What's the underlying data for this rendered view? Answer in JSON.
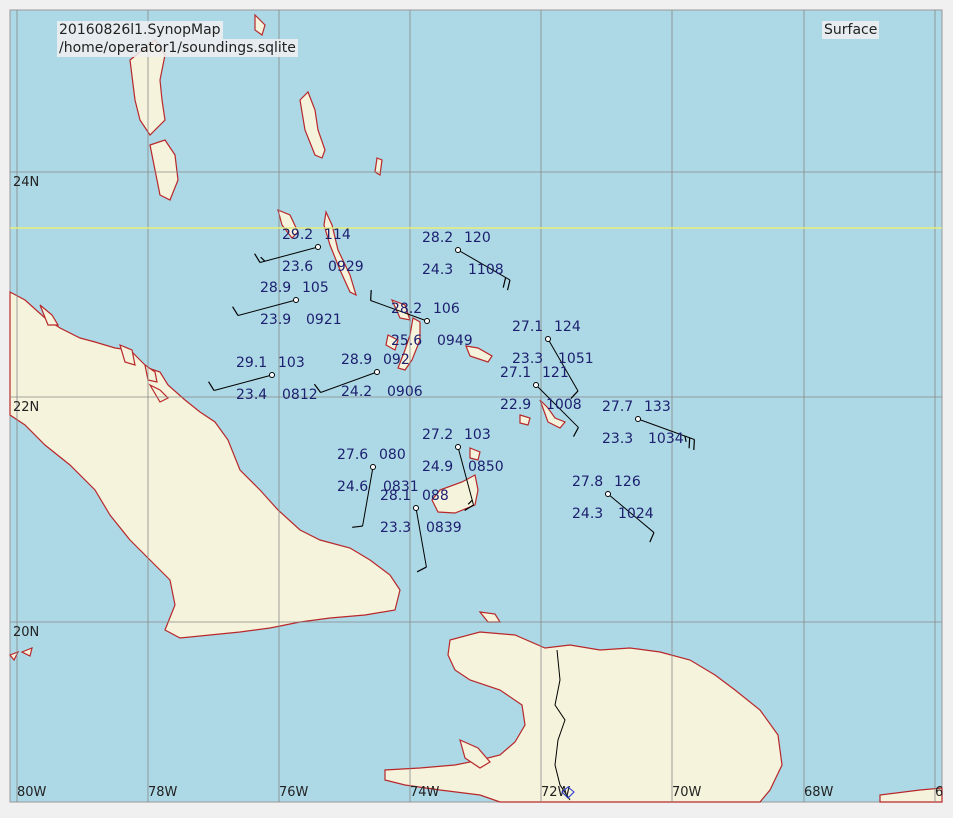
{
  "header": {
    "title": "20160826l1.SynopMap",
    "db_path": "/home/operator1/soundings.sqlite",
    "level": "Surface"
  },
  "colors": {
    "ocean": "#add8e6",
    "land": "#f5f3dc",
    "coast": "#b8282a",
    "grid": "#888888",
    "highlight_line": "#e6ee7a",
    "station_text": "#1c1f6e",
    "barb": "#000000"
  },
  "grid": {
    "lat_labels": [
      "24N",
      "22N",
      "20N"
    ],
    "lon_labels": [
      "80W",
      "78W",
      "76W",
      "74W",
      "72W",
      "70W",
      "68W",
      "6"
    ]
  },
  "stations": [
    {
      "temp": "29.2",
      "dew": "23.6",
      "pres": "114",
      "time": "0929",
      "wind_dir": 255,
      "wind_kt": 15
    },
    {
      "temp": "28.2",
      "dew": "24.3",
      "pres": "120",
      "time": "1108",
      "wind_dir": 120,
      "wind_kt": 20
    },
    {
      "temp": "28.9",
      "dew": "23.9",
      "pres": "105",
      "time": "0921",
      "wind_dir": 255,
      "wind_kt": 10
    },
    {
      "temp": "28.2",
      "dew": "25.6",
      "pres": "106",
      "time": "0949",
      "wind_dir": 290,
      "wind_kt": 10
    },
    {
      "temp": "27.1",
      "dew": "23.3",
      "pres": "124",
      "time": "1051",
      "wind_dir": 150,
      "wind_kt": 10
    },
    {
      "temp": "29.1",
      "dew": "23.4",
      "pres": "103",
      "time": "0812",
      "wind_dir": 255,
      "wind_kt": 10
    },
    {
      "temp": "28.9",
      "dew": "24.2",
      "pres": "092",
      "time": "0906",
      "wind_dir": 250,
      "wind_kt": 10
    },
    {
      "temp": "27.1",
      "dew": "22.9",
      "pres": "121",
      "time": "1008",
      "wind_dir": 135,
      "wind_kt": 10
    },
    {
      "temp": "27.7",
      "dew": "23.3",
      "pres": "133",
      "time": "1034",
      "wind_dir": 110,
      "wind_kt": 25
    },
    {
      "temp": "27.2",
      "dew": "24.9",
      "pres": "103",
      "time": "0850",
      "wind_dir": 165,
      "wind_kt": 15
    },
    {
      "temp": "27.6",
      "dew": "24.6",
      "pres": "080",
      "time": "0831",
      "wind_dir": 190,
      "wind_kt": 10
    },
    {
      "temp": "28.1",
      "dew": "23.3",
      "pres": "088",
      "time": "0839",
      "wind_dir": 170,
      "wind_kt": 10
    },
    {
      "temp": "27.8",
      "dew": "24.3",
      "pres": "126",
      "time": "1024",
      "wind_dir": 130,
      "wind_kt": 10
    }
  ]
}
